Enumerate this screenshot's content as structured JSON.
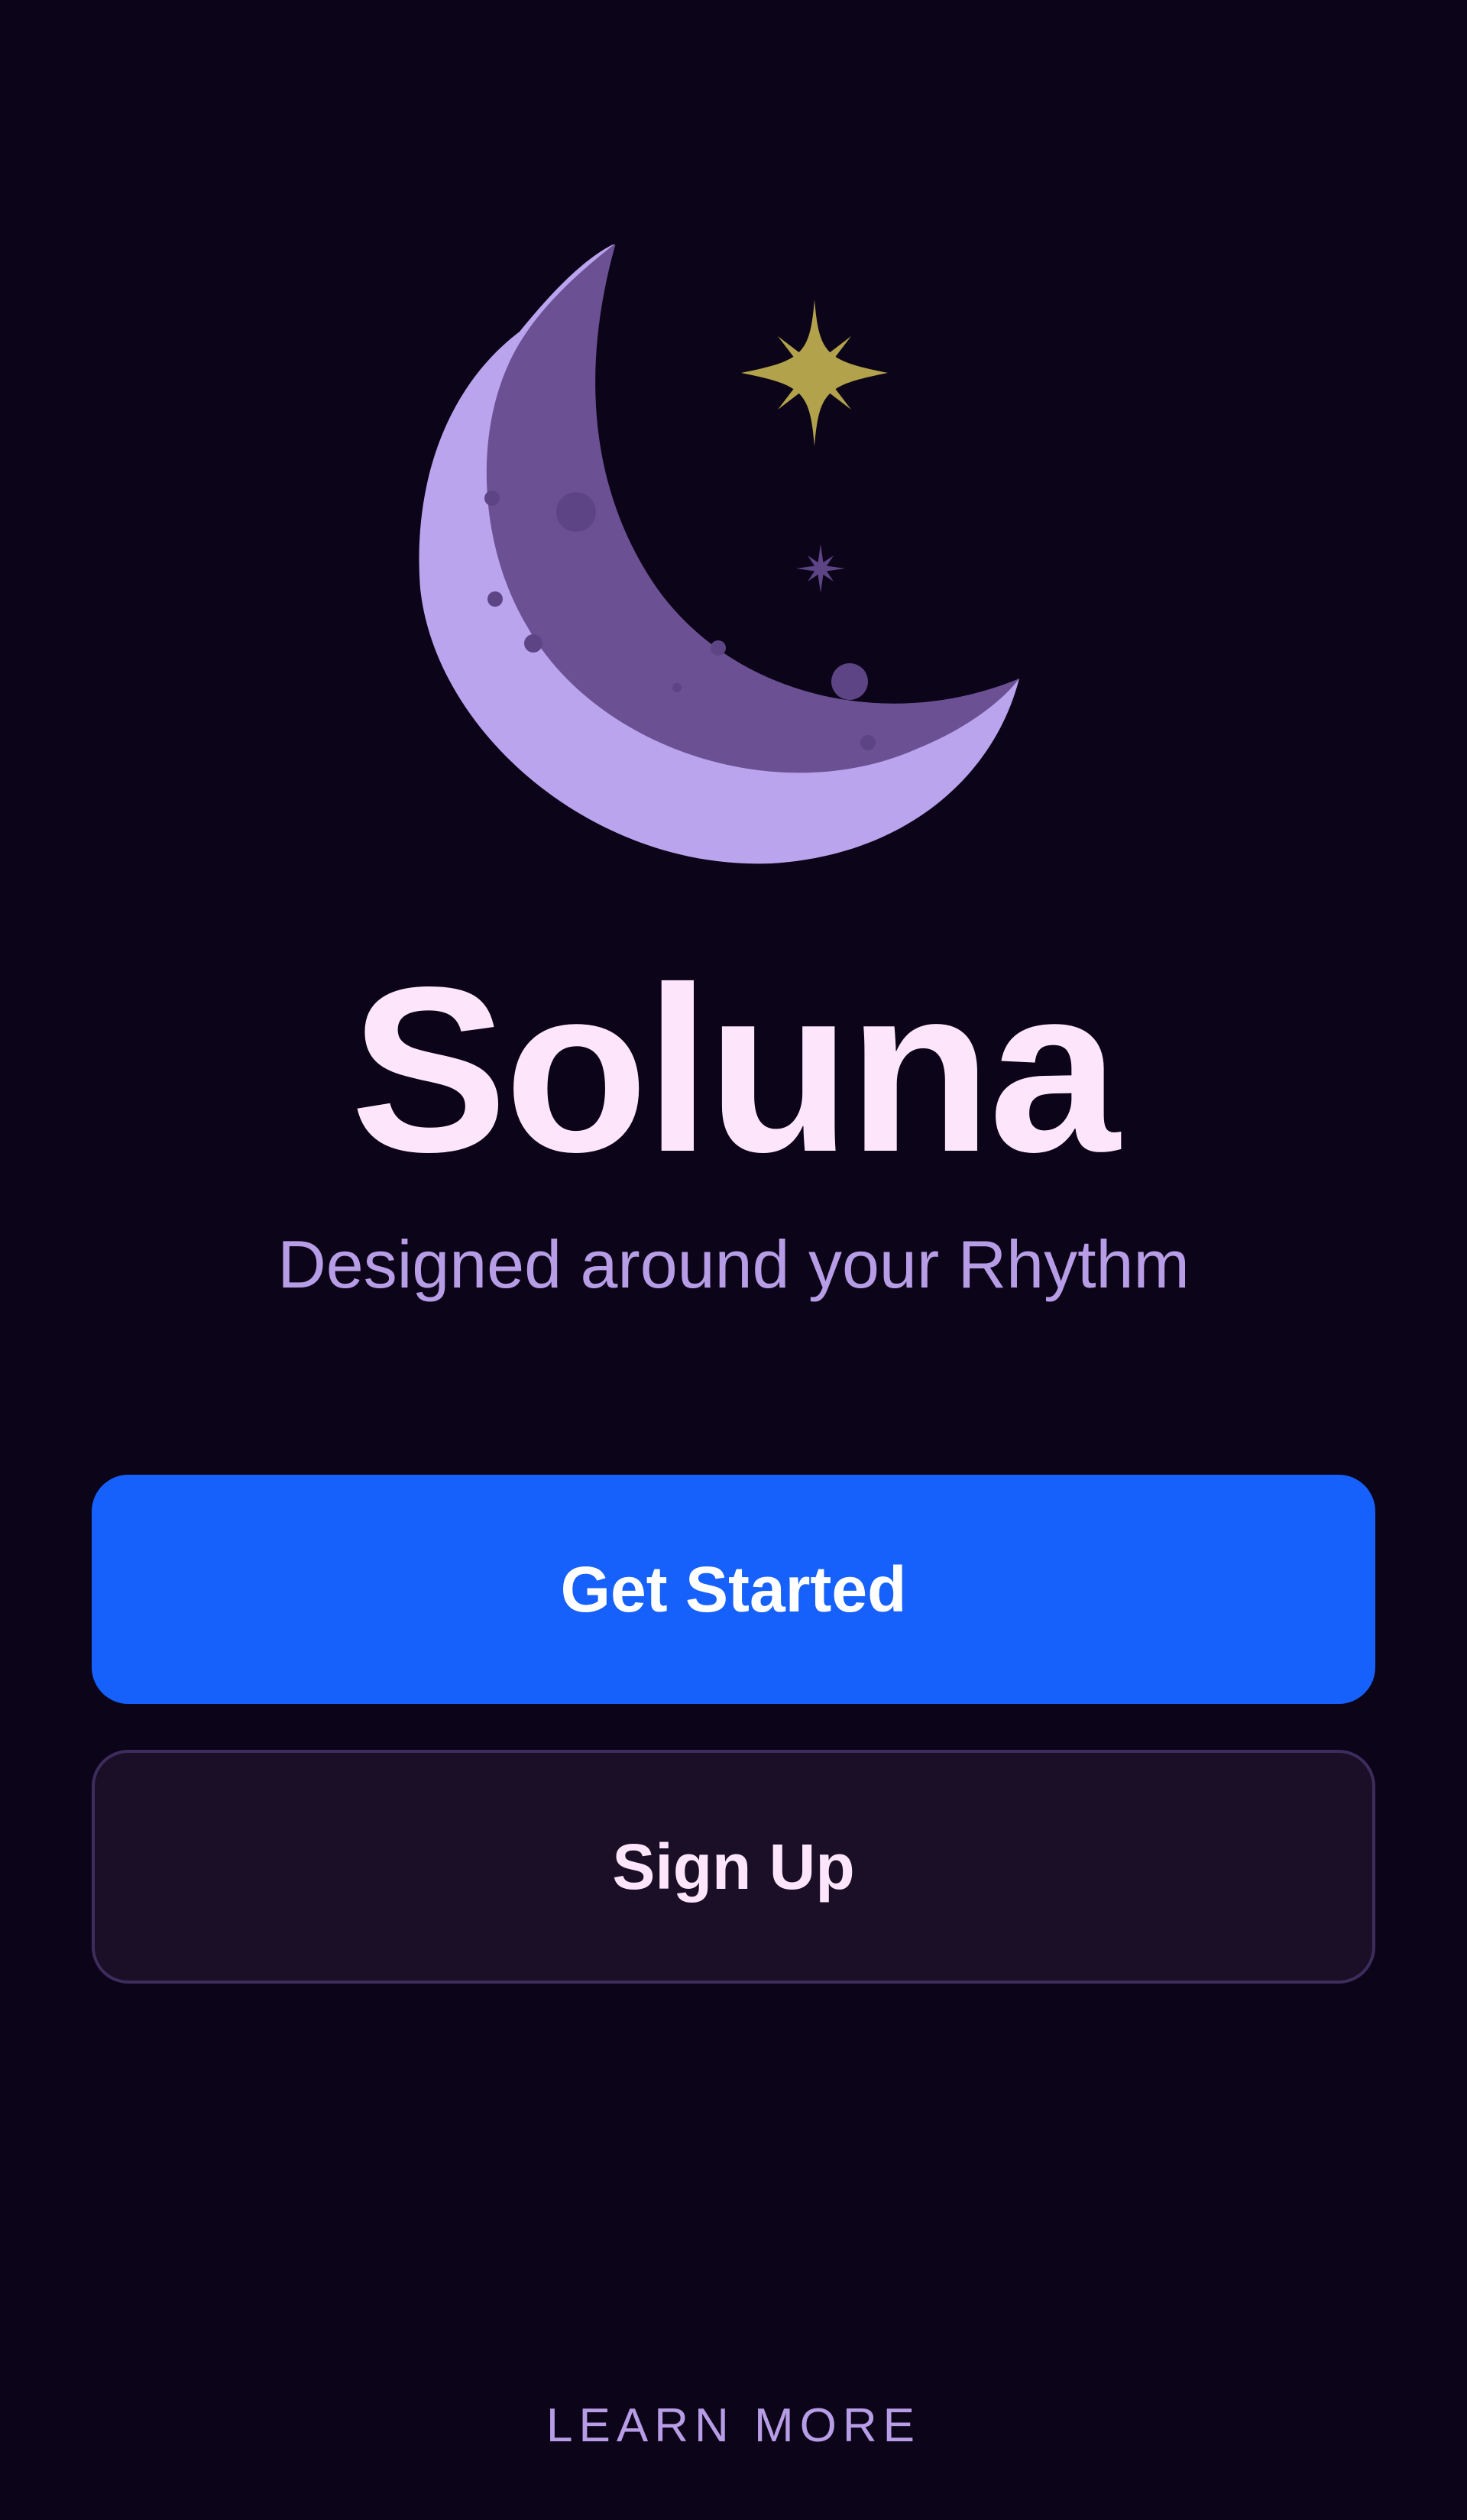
{
  "app": {
    "title": "Soluna",
    "tagline": "Designed around your Rhythm"
  },
  "actions": {
    "get_started_label": "Get Started",
    "sign_up_label": "Sign Up",
    "learn_more_label": "LEARN MORE"
  },
  "illustration": {
    "icons": [
      "crescent-moon-icon",
      "sparkle-star-icon",
      "small-star-icon"
    ]
  },
  "colors": {
    "background": "#0c0419",
    "title": "#fde6fb",
    "accent_text": "#b79de6",
    "primary_button": "#1660fb",
    "secondary_button": "#1a0f26",
    "secondary_border": "#3d2c5c",
    "moon_light": "#bba4ee",
    "moon_dark": "#6b5193",
    "star_gold": "#b2a24b"
  }
}
